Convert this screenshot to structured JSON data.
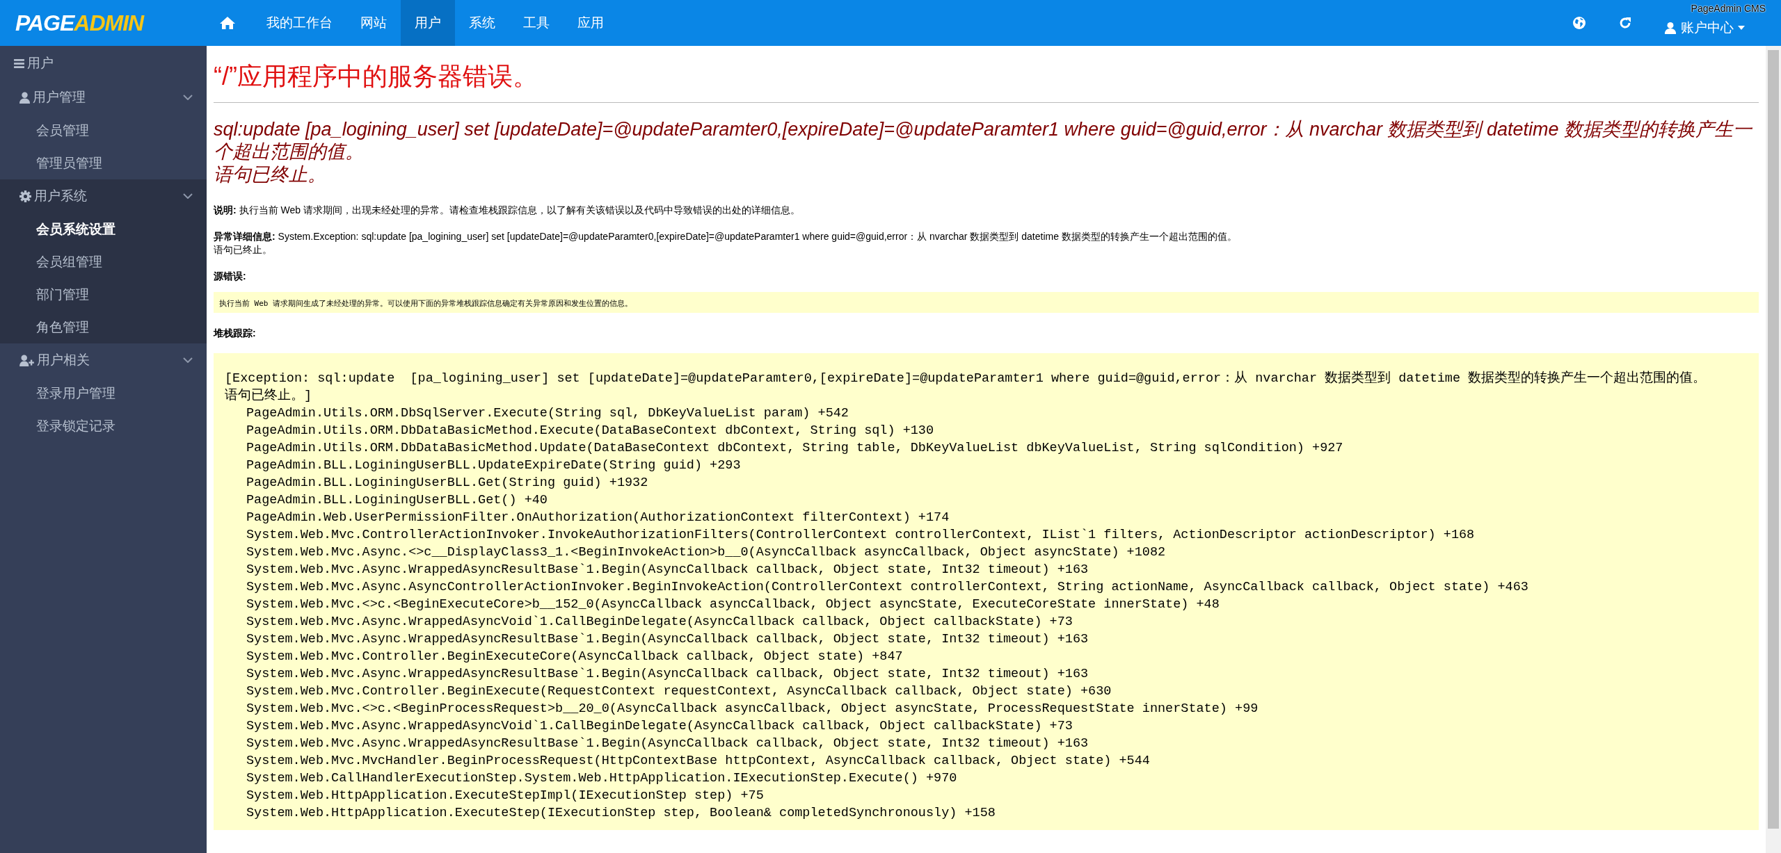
{
  "top_bar": {
    "logo": {
      "part_1": "PAGE",
      "part_2": "ADMIN"
    },
    "nav": [
      {
        "label": "我的工作台",
        "selected": false
      },
      {
        "label": "网站",
        "selected": false
      },
      {
        "label": "用户",
        "selected": true
      },
      {
        "label": "系统",
        "selected": false
      },
      {
        "label": "工具",
        "selected": false
      },
      {
        "label": "应用",
        "selected": false
      }
    ],
    "account": "账户中心",
    "tooltip": "PageAdmin CMS"
  },
  "sidebar": {
    "title": "用户",
    "groups": [
      {
        "label": "用户管理",
        "expanded": true,
        "items": [
          {
            "label": "会员管理",
            "selected": false
          },
          {
            "label": "管理员管理",
            "selected": false
          }
        ]
      },
      {
        "label": "用户系统",
        "expanded": true,
        "items": [
          {
            "label": "会员系统设置",
            "selected": true
          },
          {
            "label": "会员组管理",
            "selected": false
          },
          {
            "label": "部门管理",
            "selected": false
          },
          {
            "label": "角色管理",
            "selected": false
          }
        ]
      },
      {
        "label": "用户相关",
        "expanded": true,
        "items": [
          {
            "label": "登录用户管理",
            "selected": false
          },
          {
            "label": "登录锁定记录",
            "selected": false
          }
        ]
      }
    ]
  },
  "error": {
    "title": "“/”应用程序中的服务器错误。",
    "message": "sql:update  [pa_logining_user] set [updateDate]=@updateParamter0,[expireDate]=@updateParamter1 where guid=@guid,error：从 nvarchar 数据类型到 datetime 数据类型的转换产生一个超出范围的值。",
    "message_end": "语句已终止。",
    "description": "**说明:** 执行当前 Web 请求期间，出现未经处理的异常。请检查堆栈跟踪信息，以了解有关该错误以及代码中导致错误的出处的详细信息。",
    "details": "**异常详细信息:** System.Exception: sql:update  [pa_logining_user] set [updateDate]=@updateParamter0,[expireDate]=@updateParamter1 where guid=@guid,error：从 nvarchar 数据类型到 datetime 数据类型的转换产生一个超出范围的值。",
    "details_end": "语句已终止。",
    "source_heading": "源错误:",
    "source_note": "执行当前 Web 请求期间生成了未经处理的异常。可以使用下面的异常堆栈跟踪信息确定有关异常原因和发生位置的信息。",
    "stack_heading": "堆栈跟踪:",
    "stack_header": [
      "[Exception: sql:update  [pa_logining_user] set [updateDate]=@updateParamter0,[expireDate]=@updateParamter1 where guid=@guid,error：从 nvarchar 数据类型到 datetime 数据类型的转换产生一个超出范围的值。",
      "语句已终止。]"
    ],
    "stack_lines": [
      "PageAdmin.Utils.ORM.DbSqlServer.Execute(String sql, DbKeyValueList param) +542",
      "PageAdmin.Utils.ORM.DbDataBasicMethod.Execute(DataBaseContext dbContext, String sql) +130",
      "PageAdmin.Utils.ORM.DbDataBasicMethod.Update(DataBaseContext dbContext, String table, DbKeyValueList dbKeyValueList, String sqlCondition) +927",
      "PageAdmin.BLL.LoginingUserBLL.UpdateExpireDate(String guid) +293",
      "PageAdmin.BLL.LoginingUserBLL.Get(String guid) +1932",
      "PageAdmin.BLL.LoginingUserBLL.Get() +40",
      "PageAdmin.Web.UserPermissionFilter.OnAuthorization(AuthorizationContext filterContext) +174",
      "System.Web.Mvc.ControllerActionInvoker.InvokeAuthorizationFilters(ControllerContext controllerContext, IList`1 filters, ActionDescriptor actionDescriptor) +168",
      "System.Web.Mvc.Async.<>c__DisplayClass3_1.<BeginInvokeAction>b__0(AsyncCallback asyncCallback, Object asyncState) +1082",
      "System.Web.Mvc.Async.WrappedAsyncResultBase`1.Begin(AsyncCallback callback, Object state, Int32 timeout) +163",
      "System.Web.Mvc.Async.AsyncControllerActionInvoker.BeginInvokeAction(ControllerContext controllerContext, String actionName, AsyncCallback callback, Object state) +463",
      "System.Web.Mvc.<>c.<BeginExecuteCore>b__152_0(AsyncCallback asyncCallback, Object asyncState, ExecuteCoreState innerState) +48",
      "System.Web.Mvc.Async.WrappedAsyncVoid`1.CallBeginDelegate(AsyncCallback callback, Object callbackState) +73",
      "System.Web.Mvc.Async.WrappedAsyncResultBase`1.Begin(AsyncCallback callback, Object state, Int32 timeout) +163",
      "System.Web.Mvc.Controller.BeginExecuteCore(AsyncCallback callback, Object state) +847",
      "System.Web.Mvc.Async.WrappedAsyncResultBase`1.Begin(AsyncCallback callback, Object state, Int32 timeout) +163",
      "System.Web.Mvc.Controller.BeginExecute(RequestContext requestContext, AsyncCallback callback, Object state) +630",
      "System.Web.Mvc.<>c.<BeginProcessRequest>b__20_0(AsyncCallback asyncCallback, Object asyncState, ProcessRequestState innerState) +99",
      "System.Web.Mvc.Async.WrappedAsyncVoid`1.CallBeginDelegate(AsyncCallback callback, Object callbackState) +73",
      "System.Web.Mvc.Async.WrappedAsyncResultBase`1.Begin(AsyncCallback callback, Object state, Int32 timeout) +163",
      "System.Web.Mvc.MvcHandler.BeginProcessRequest(HttpContextBase httpContext, AsyncCallback callback, Object state) +544",
      "System.Web.CallHandlerExecutionStep.System.Web.HttpApplication.IExecutionStep.Execute() +970",
      "System.Web.HttpApplication.ExecuteStepImpl(IExecutionStep step) +75",
      "System.Web.HttpApplication.ExecuteStep(IExecutionStep step, Boolean& completedSynchronously) +158"
    ]
  }
}
